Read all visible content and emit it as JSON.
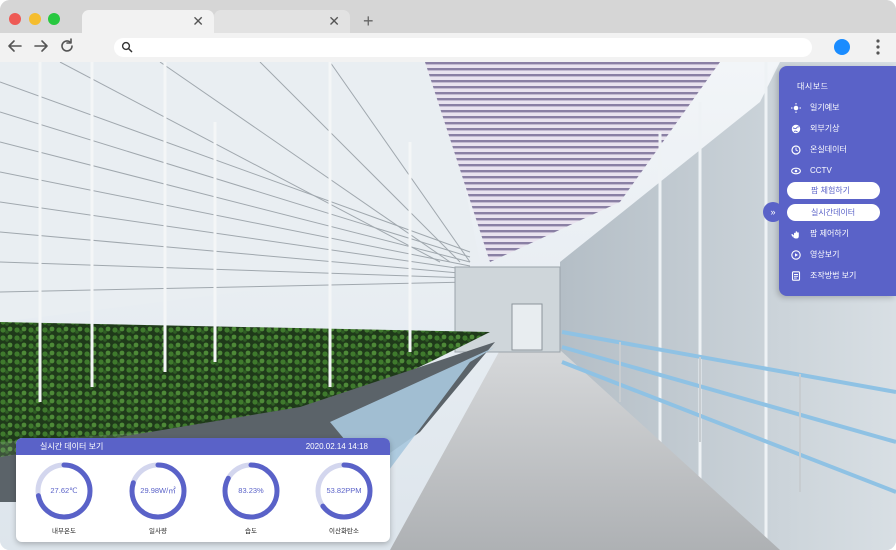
{
  "browser": {
    "tabs": [
      {
        "close_glyph": "✕"
      },
      {
        "close_glyph": "✕"
      }
    ],
    "new_tab_glyph": "+",
    "address": {
      "value": "",
      "placeholder": ""
    },
    "icons": [
      "back-arrow-icon",
      "forward-arrow-icon",
      "reload-icon",
      "search-icon",
      "profile-icon",
      "kebab-menu-icon"
    ],
    "colors": {
      "profile": "#1a8cff",
      "close": "#ee5a55",
      "minimize": "#f5bd2e",
      "maximize": "#28c840"
    }
  },
  "dashboard": {
    "title": "대시보드",
    "items": [
      {
        "label": "일기예보",
        "icon": "sun-icon"
      },
      {
        "label": "외부기상",
        "icon": "globe-icon"
      },
      {
        "label": "온실데이터",
        "icon": "clock-icon"
      },
      {
        "label": "CCTV",
        "icon": "eye-icon"
      }
    ],
    "pills": [
      {
        "label": "팜 체험하기"
      },
      {
        "label": "실시간데이터"
      }
    ],
    "items_bottom": [
      {
        "label": "팜 제어하기",
        "icon": "hand-icon"
      },
      {
        "label": "영상보기",
        "icon": "play-icon"
      },
      {
        "label": "조작방법 보기",
        "icon": "document-icon"
      }
    ],
    "collapse_glyph": "»",
    "accent": "#5a62c8"
  },
  "realtime": {
    "title": "실시간 데이터 보기",
    "timestamp": "2020.02.14 14:18",
    "gauges": [
      {
        "value": "27.62℃",
        "label": "내부온도",
        "fraction": 0.72
      },
      {
        "value": "29.98W/㎡",
        "label": "일사량",
        "fraction": 0.8
      },
      {
        "value": "83.23%",
        "label": "습도",
        "fraction": 0.83
      },
      {
        "value": "53.82PPM",
        "label": "이산화탄소",
        "fraction": 0.65
      }
    ]
  }
}
